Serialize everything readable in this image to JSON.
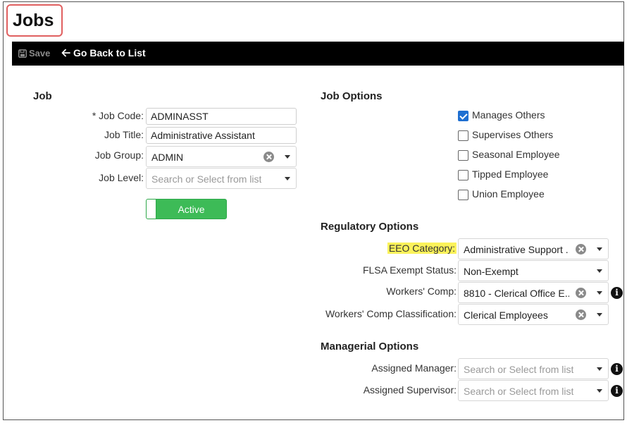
{
  "page": {
    "title": "Jobs"
  },
  "toolbar": {
    "save_label": "Save",
    "back_label": "Go Back to List"
  },
  "job": {
    "heading": "Job",
    "job_code": {
      "label": "* Job Code:",
      "value": "ADMINASST"
    },
    "job_title": {
      "label": "Job Title:",
      "value": "Administrative Assistant"
    },
    "job_group": {
      "label": "Job Group:",
      "value": "ADMIN"
    },
    "job_level": {
      "label": "Job Level:",
      "placeholder": "Search or Select from list"
    },
    "status_toggle": {
      "label": "Active",
      "on": true
    }
  },
  "job_options": {
    "heading": "Job Options",
    "items": [
      {
        "label": "Manages Others",
        "checked": true
      },
      {
        "label": "Supervises Others",
        "checked": false
      },
      {
        "label": "Seasonal Employee",
        "checked": false
      },
      {
        "label": "Tipped Employee",
        "checked": false
      },
      {
        "label": "Union Employee",
        "checked": false
      }
    ]
  },
  "regulatory": {
    "heading": "Regulatory Options",
    "eeo": {
      "label": "EEO Category:",
      "value": "Administrative Support ..."
    },
    "flsa": {
      "label": "FLSA Exempt Status:",
      "value": "Non-Exempt"
    },
    "workers_comp": {
      "label": "Workers' Comp:",
      "value": "8810 - Clerical Office E..."
    },
    "wc_class": {
      "label": "Workers' Comp Classification:",
      "value": "Clerical Employees"
    }
  },
  "managerial": {
    "heading": "Managerial Options",
    "manager": {
      "label": "Assigned Manager:",
      "placeholder": "Search or Select from list"
    },
    "supervisor": {
      "label": "Assigned Supervisor:",
      "placeholder": "Search or Select from list"
    }
  },
  "colors": {
    "toggle_active": "#3dbb57",
    "checkbox_checked": "#1f6fd1",
    "highlight": "#fbf25a",
    "title_border": "#e06060"
  },
  "icons": {
    "save": "save-icon",
    "back": "arrow-left-icon",
    "clear": "clear-icon",
    "dropdown": "chevron-down-icon",
    "info": "info-icon"
  }
}
